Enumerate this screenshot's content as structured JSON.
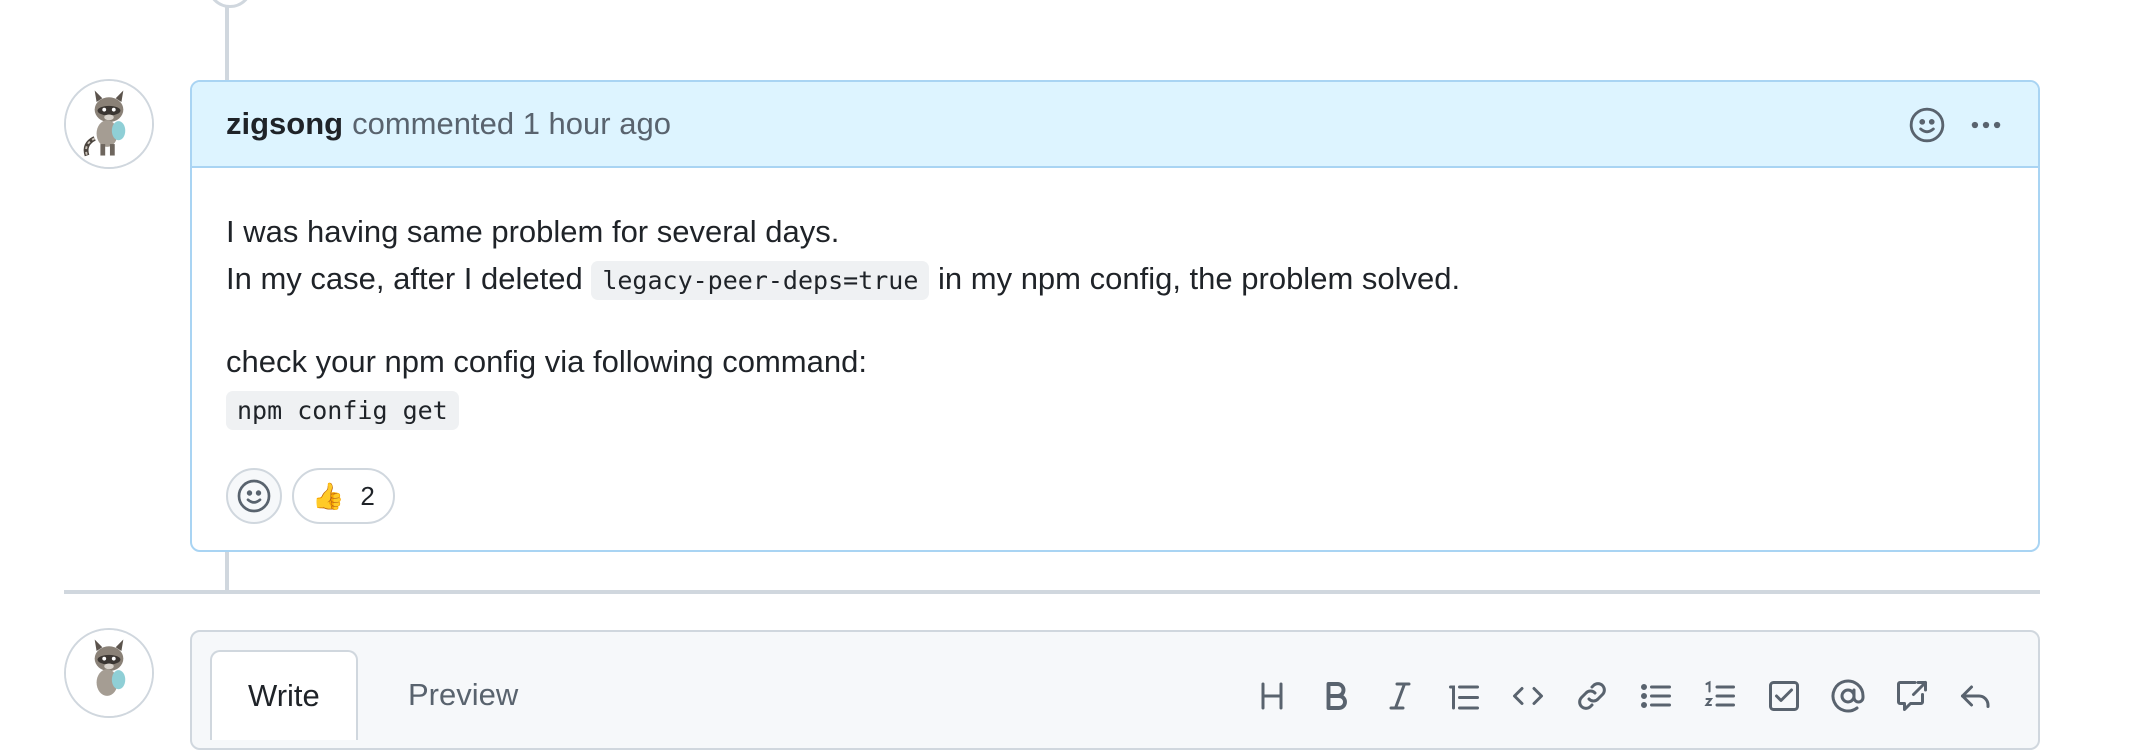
{
  "comment": {
    "author": "zigsong",
    "action": "commented",
    "time": "1 hour ago",
    "body": {
      "line1": "I was having same problem for several days.",
      "line2_before": "In my case, after I deleted",
      "line2_code": "legacy-peer-deps=true",
      "line2_after": "in my npm config, the problem solved.",
      "line3": "check your npm config via following command:",
      "command": "npm config get"
    },
    "reactions": [
      {
        "emoji": "👍",
        "count": "2",
        "icon": "thumbs-up-icon"
      }
    ],
    "header_icons": [
      "smiley-icon",
      "kebab-horizontal-icon"
    ]
  },
  "editor": {
    "tabs": [
      "Write",
      "Preview"
    ],
    "active_tab": "Write",
    "toolbar": [
      "heading-icon",
      "bold-icon",
      "italic-icon",
      "quote-icon",
      "code-icon",
      "link-icon",
      "unordered-list-icon",
      "ordered-list-icon",
      "task-list-icon",
      "mention-icon",
      "reference-icon",
      "reply-icon"
    ]
  },
  "colors": {
    "header_bg": "#ddf4ff",
    "header_border": "#a9d4f3",
    "text": "#1f2328",
    "muted": "#59636e",
    "code_bg": "#eff1f3"
  }
}
